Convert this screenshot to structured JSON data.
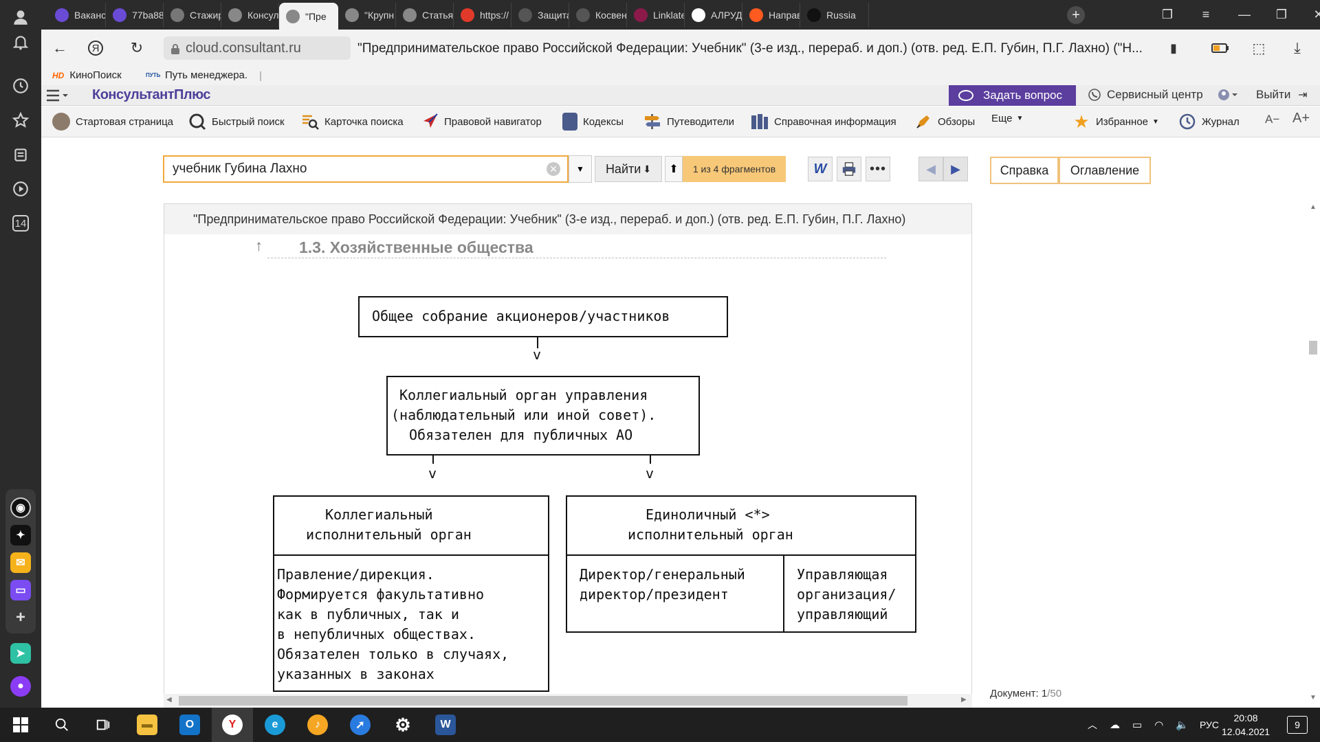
{
  "browser": {
    "tabs": [
      {
        "label": "Ваканс",
        "icon": "proton-icon",
        "color": "#6a4bd6"
      },
      {
        "label": "77ba88",
        "icon": "proton-icon",
        "color": "#6a4bd6"
      },
      {
        "label": "Стажир",
        "icon": "gear-icon",
        "color": "#777777"
      },
      {
        "label": "Консул",
        "icon": "consultant-icon",
        "color": "#888888"
      },
      {
        "label": "\"Пре",
        "icon": "consultant-icon",
        "color": "#888888",
        "active": true
      },
      {
        "label": "\"Крупн",
        "icon": "consultant-icon",
        "color": "#888888"
      },
      {
        "label": "Статья",
        "icon": "consultant-icon",
        "color": "#888888"
      },
      {
        "label": "https://",
        "icon": "yandex-icon",
        "color": "#e23a2a"
      },
      {
        "label": "Защита",
        "icon": "bird-icon",
        "color": "#555555"
      },
      {
        "label": "Косвен",
        "icon": "bird-icon",
        "color": "#555555"
      },
      {
        "label": "Linklate",
        "icon": "linklaters-icon",
        "color": "#8b1a4a"
      },
      {
        "label": "АЛРУД",
        "icon": "alrud-icon",
        "color": "#ffffff"
      },
      {
        "label": "Направ",
        "icon": "orange-icon",
        "color": "#ff5a1f"
      },
      {
        "label": "Russia",
        "icon": "flag-icon",
        "color": "#111111"
      }
    ],
    "address": {
      "domain": "cloud.consultant.ru",
      "title": "\"Предпринимательское право Российской Федерации: Учебник\" (3-е изд., перераб. и доп.) (отв. ред. Е.П. Губин, П.Г. Лахно) (\"Н..."
    },
    "bookmarks": [
      {
        "label": "КиноПоиск",
        "icon": "HD"
      },
      {
        "label": "Путь менеджера.",
        "icon": "ПУТЬ"
      }
    ],
    "side_badge": "14"
  },
  "consultant": {
    "logo": "КонсультантПлюс",
    "ask_label": "Задать вопрос",
    "service_label": "Сервисный центр",
    "exit_label": "Выйти",
    "toolbar": [
      {
        "label": "Стартовая страница",
        "icon": "home-avatar-icon"
      },
      {
        "label": "Быстрый поиск",
        "icon": "search-icon"
      },
      {
        "label": "Карточка поиска",
        "icon": "search-card-icon"
      },
      {
        "label": "Правовой навигатор",
        "icon": "navigator-icon"
      },
      {
        "label": "Кодексы",
        "icon": "codes-icon"
      },
      {
        "label": "Путеводители",
        "icon": "guide-icon"
      },
      {
        "label": "Справочная информация",
        "icon": "reference-icon"
      },
      {
        "label": "Обзоры",
        "icon": "reviews-icon"
      },
      {
        "label": "Еще",
        "icon": "dropdown-icon"
      },
      {
        "label": "Избранное",
        "icon": "star-icon"
      },
      {
        "label": "Журнал",
        "icon": "clock-icon"
      }
    ],
    "font_minus": "A−",
    "font_plus": "A+",
    "search": {
      "value": "учебник Губина Лахно",
      "find_label": "Найти",
      "fragments": "1 из 4 фрагментов"
    },
    "help_label": "Справка",
    "toc_label": "Оглавление",
    "doc_count_label": "Документ:",
    "doc_count_value": "1",
    "doc_count_total": "/50"
  },
  "document": {
    "title": "\"Предпринимательское право Российской Федерации: Учебник\" (3-е изд., перераб. и доп.) (отв. ред. Е.П. Губин, П.Г. Лахно)",
    "section": "1.3. Хозяйственные общества",
    "diagram": {
      "top": "Общее собрание акционеров/участников",
      "council": [
        "Коллегиальный орган управления",
        "(наблюдательный или иной совет).",
        "Обязателен для публичных АО"
      ],
      "arrow": "v",
      "collegial_head": [
        "Коллегиальный",
        "исполнительный орган"
      ],
      "collegial_body": [
        "Правление/дирекция.",
        "Формируется факультативно",
        "как в публичных, так и",
        "в непубличных обществах.",
        "Обязателен только в случаях,",
        "указанных в законах"
      ],
      "sole_head": [
        "Единоличный <*>",
        "исполнительный орган"
      ],
      "sole_left": [
        "Директор/генеральный",
        "директор/президент"
      ],
      "sole_right": [
        "Управляющая",
        "организация/",
        "управляющий"
      ]
    }
  },
  "taskbar": {
    "lang": "РУС",
    "time": "20:08",
    "date": "12.04.2021",
    "notifications": "9"
  }
}
